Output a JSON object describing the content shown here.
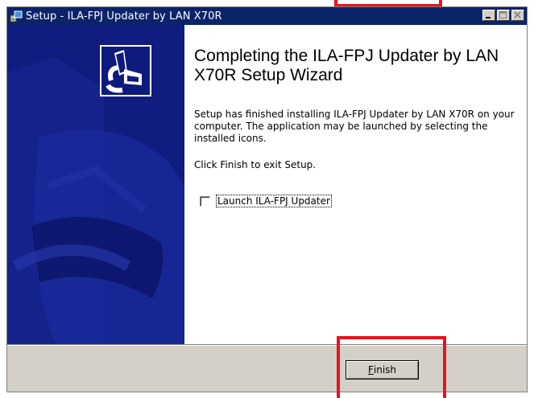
{
  "window": {
    "title": "Setup - ILA-FPJ Updater by LAN X70R"
  },
  "wizard": {
    "heading": "Completing the ILA-FPJ Updater by LAN X70R Setup Wizard",
    "body": "Setup has finished installing ILA-FPJ Updater by LAN X70R on your computer. The application may be launched by selecting the installed icons.",
    "finish_hint": "Click Finish to exit Setup.",
    "launch_checkbox_label": "Launch ILA-FPJ Updater",
    "launch_checked": false
  },
  "buttons": {
    "finish_label_rest": "inish",
    "finish_accel": "F"
  },
  "icons": {
    "title": "setup-app-icon",
    "wizard": "installer-computer-icon",
    "minimize": "minimize-icon",
    "maximize": "maximize-icon",
    "close": "close-icon"
  },
  "colors": {
    "titlebar": "#0a246a",
    "side_panel": "#0f1a7e",
    "annotation": "#e8141e"
  }
}
